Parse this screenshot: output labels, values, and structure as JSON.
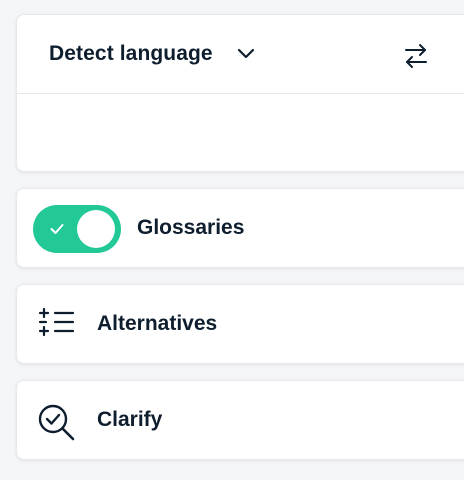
{
  "source_language": {
    "label": "Detect language",
    "dropdown_icon": "chevron-down-icon",
    "swap_icon": "swap-arrows-icon"
  },
  "glossaries": {
    "label": "Glossaries",
    "toggle_on": true,
    "toggle_color": "#22c997"
  },
  "alternatives": {
    "label": "Alternatives",
    "icon": "sparkle-list-icon"
  },
  "clarify": {
    "label": "Clarify",
    "icon": "magnifier-check-icon"
  },
  "colors": {
    "text": "#0f1e2e",
    "accent": "#22c997"
  }
}
